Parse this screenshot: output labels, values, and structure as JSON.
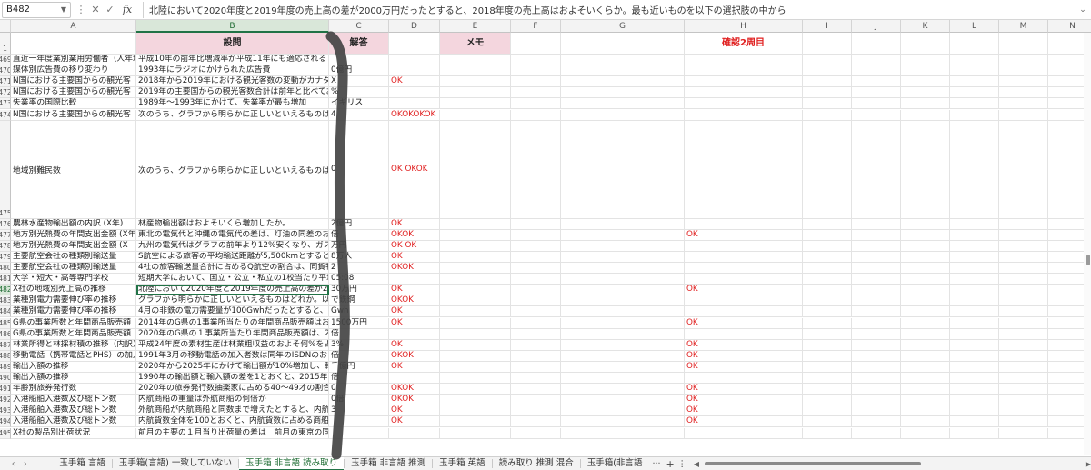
{
  "formula_bar": {
    "cell_ref": "B482",
    "fx": "fx",
    "content": "北陸において2020年度と2019年度の売上高の差が2000万円だったとすると、2018年度の売上高はおよそいくらか。最も近いものを以下の選択肢の中から"
  },
  "columns": [
    "A",
    "B",
    "C",
    "D",
    "E",
    "F",
    "G",
    "H",
    "I",
    "J",
    "K",
    "L",
    "M",
    "N",
    "O"
  ],
  "active_column": "B",
  "header_row": {
    "row_num": "1",
    "b": "設問",
    "c": "解答",
    "e": "メモ",
    "h": "確認2周目"
  },
  "rows": [
    {
      "num": "469",
      "a": "直近一年度業別業用労働者（人年均",
      "b": "平成10年の前年比増減率が平成11年にも適応される",
      "c": "",
      "d": "",
      "h": ""
    },
    {
      "num": "470",
      "a": "媒体別広告費の移り変わり",
      "b": "1993年にラジオにかけられた広告費",
      "c": "0億円",
      "d": "",
      "h": ""
    },
    {
      "num": "471",
      "a": "N国における主要国からの観光客",
      "b": "2018年から2019年における観光客数の変動がカナダの",
      "c": "X",
      "d": "OK",
      "h": ""
    },
    {
      "num": "472",
      "a": "N国における主要国からの観光客",
      "b": "2019年の主要国からの観光客数合計は前年と比べてお",
      "c": "%",
      "d": "",
      "h": ""
    },
    {
      "num": "473",
      "a": "失業率の国際比較",
      "b": "1989年〜1993年にかけて、失業率が最も増加",
      "c": "イギリス",
      "d": "",
      "h": ""
    },
    {
      "num": "474",
      "a": "N国における主要国からの観光客",
      "b": "次のうち、グラフから明らかに正しいといえるものは",
      "c": "4",
      "d": "OKOKOKOK",
      "h": ""
    },
    {
      "num": "475",
      "a": "地域別難民数",
      "b": "次のうち、グラフから明らかに正しいといえるものは",
      "c": "0",
      "d": "OK OKOK",
      "h": "",
      "tall": true
    },
    {
      "num": "476",
      "a": "農林水産物輸出額の内訳 (X年)",
      "b": "林産物輸出額はおよそいくら増加したか。",
      "c": "2億円",
      "d": "OK",
      "h": ""
    },
    {
      "num": "477",
      "a": "地方別光熱費の年間支出金額 (X年)",
      "b": "東北の電気代と沖縄の電気代の差は、灯油の同差のお",
      "c": "倍",
      "d": "OKOK",
      "h": "OK"
    },
    {
      "num": "478",
      "a": "地方別光熱費の年間支出金額 (X",
      "b": "九州の電気代はグラフの前年より12%安くなり、ガス",
      "c": "万円",
      "d": "OK OK",
      "h": ""
    },
    {
      "num": "479",
      "a": "主要航空会社の種類別輸送量",
      "b": "S航空による旅客の平均輸送距離が5,500kmとすると、",
      "c": "8万人",
      "d": "OK",
      "h": ""
    },
    {
      "num": "480",
      "a": "主要航空会社の種類別輸送量",
      "b": "4社の旅客輸送量合計に占めるQ航空の割合は、同貨物",
      "c": "2",
      "d": "OKOK",
      "h": ""
    },
    {
      "num": "481",
      "a": "大学・短大・高等専門学校",
      "b": "短期大学において、国立・公立・私立の1校当たり平均",
      "c": "05:08",
      "d": "",
      "h": ""
    },
    {
      "num": "482",
      "a": "X社の地域別売上高の推移",
      "b": "北陸において2020年度と2019年度の売上高の差が2000",
      "c": "30万円",
      "d": "OK",
      "h": "OK",
      "selected": true
    },
    {
      "num": "483",
      "a": "業種別電力需要伸び率の推移",
      "b": "グラフから明らかに正しいといえるものはどれか。以",
      "c": "で鉄鋼",
      "d": "OKOK",
      "h": ""
    },
    {
      "num": "484",
      "a": "業種別電力需要伸び率の推移",
      "b": "4月の非鉄の電力需要量が100Gwhだったとすると、昨",
      "c": "Gwh",
      "d": "OK",
      "h": ""
    },
    {
      "num": "485",
      "a": "G県の事業所数と年間商品販売額",
      "b": "2014年のG県の1事業所当たりの年間商品販売額はおよ",
      "c": "1500万円",
      "d": "OK",
      "h": "OK"
    },
    {
      "num": "486",
      "a": "G県の事業所数と年間商品販売額",
      "b": "2020年のG県の１事業所当たり年間商品販売額は、20",
      "c": "倍",
      "d": "",
      "h": ""
    },
    {
      "num": "487",
      "a": "林業所得と林採材積の推移（内訳）",
      "b": "平成24年度の素材生産は林業粗収益のおよそ何%を占め",
      "c": "3%",
      "d": "OK",
      "h": "OK"
    },
    {
      "num": "488",
      "a": "移動電話（携帯電話とPHS）の加入",
      "b": "1991年3月の移動電話の加入者数は同年のISDNのおよ",
      "c": "倍",
      "d": "OKOK",
      "h": "OK"
    },
    {
      "num": "489",
      "a": "輸出入額の推移",
      "b": "2020年から2025年にかけて輸出額が10%増加し、輸入",
      "c": "千億円",
      "d": "OK",
      "h": "OK"
    },
    {
      "num": "490",
      "a": "輸出入額の推移",
      "b": "1990年の輸出額と輸入額の差を1とおくと、2015年の輸",
      "c": "倍",
      "d": "",
      "h": ""
    },
    {
      "num": "491",
      "a": "年齢別旅券発行数",
      "b": "2020年の旅券発行数抽楽家に占める40〜49才の割合 (%)",
      "c": "0",
      "d": "OKOK",
      "h": "OK"
    },
    {
      "num": "492",
      "a": "入港船舶入港数及び総トン数",
      "b": "内航商船の重量は外航商船の何倍か",
      "c": "0倍",
      "d": "OKOK",
      "h": "OK"
    },
    {
      "num": "493",
      "a": "入港船舶入港数及び総トン数",
      "b": "外航商船が内航商船と同数まで増えたとすると、内航",
      "c": "3",
      "d": "OK",
      "h": "OK"
    },
    {
      "num": "494",
      "a": "入港船舶入港数及び総トン数",
      "b": "内航貨数全体を100とおくと、内航貨数に占める商船は",
      "c": "",
      "d": "OK",
      "h": "OK"
    },
    {
      "num": "495",
      "a": "X社の製品別出荷状況",
      "b": "前月の主要の１月当り出荷量の差は　前月の東京の同",
      "c": "",
      "d": "",
      "h": ""
    }
  ],
  "sheet_tabs": [
    {
      "label": "玉手箱 言語",
      "active": false
    },
    {
      "label": "玉手箱(言語) 一致していない",
      "active": false
    },
    {
      "label": "玉手箱 非言語 読み取り",
      "active": true
    },
    {
      "label": "玉手箱 非言語 推測",
      "active": false
    },
    {
      "label": "玉手箱 英語",
      "active": false
    },
    {
      "label": "読み取り 推測 混合",
      "active": false
    },
    {
      "label": "玉手箱(非言語",
      "active": false
    }
  ],
  "tabs_more": "···",
  "colors": {
    "accent": "#217346",
    "header_fill": "#f4d6de",
    "ok_red": "#e02020"
  }
}
